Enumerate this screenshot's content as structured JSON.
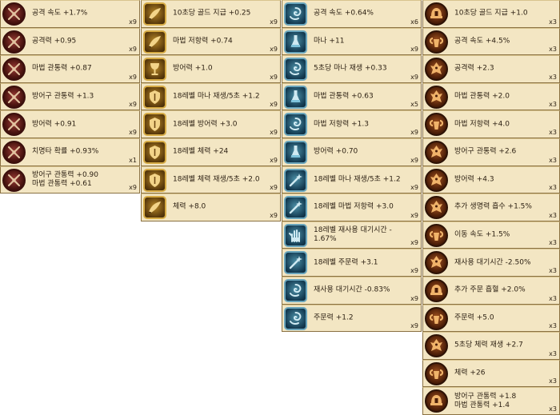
{
  "columns": [
    {
      "id": "col-1",
      "icon_style": "red",
      "items": [
        {
          "label": "공격 속도 +1.7%",
          "count": "x9",
          "icon": "swords-icon"
        },
        {
          "label": "공격력 +0.95",
          "count": "x9",
          "icon": "swords-icon"
        },
        {
          "label": "마법 관통력 +0.87",
          "count": "x9",
          "icon": "swords-icon"
        },
        {
          "label": "방어구 관통력 +1.3",
          "count": "x9",
          "icon": "swords-icon"
        },
        {
          "label": "방어력 +0.91",
          "count": "x9",
          "icon": "swords-icon"
        },
        {
          "label": "치명타 확률 +0.93%",
          "count": "x1",
          "icon": "swords-icon"
        },
        {
          "label": "방어구 관통력 +0.90\n마법 관통력 +0.61",
          "count": "x9",
          "icon": "swords-icon"
        }
      ]
    },
    {
      "id": "col-2",
      "icon_style": "gold",
      "items": [
        {
          "label": "10초당 골드 지급 +0.25",
          "count": "x9",
          "icon": "horn-icon"
        },
        {
          "label": "마법 저항력 +0.74",
          "count": "x9",
          "icon": "horn-icon"
        },
        {
          "label": "방어력 +1.0",
          "count": "x9",
          "icon": "chalice-icon"
        },
        {
          "label": "18레벨 마나 재생/5초 +1.2",
          "count": "x9",
          "icon": "shield-icon"
        },
        {
          "label": "18레벨 방어력 +3.0",
          "count": "x9",
          "icon": "shield-icon"
        },
        {
          "label": "18레벨 체력 +24",
          "count": "x9",
          "icon": "shield-icon"
        },
        {
          "label": "18레벨 체력 재생/5초 +2.0",
          "count": "x9",
          "icon": "shield-icon"
        },
        {
          "label": "체력 +8.0",
          "count": "x9",
          "icon": "horn-icon"
        }
      ]
    },
    {
      "id": "col-3",
      "icon_style": "blue",
      "items": [
        {
          "label": "공격 속도 +0.64%",
          "count": "x6",
          "icon": "swirl-icon"
        },
        {
          "label": "마나 +11",
          "count": "x9",
          "icon": "flask-icon"
        },
        {
          "label": "5초당 마나 재생 +0.33",
          "count": "x9",
          "icon": "swirl-icon"
        },
        {
          "label": "마법 관통력 +0.63",
          "count": "x5",
          "icon": "flask-icon"
        },
        {
          "label": "마법 저항력 +1.3",
          "count": "x9",
          "icon": "swirl-icon"
        },
        {
          "label": "방어력 +0.70",
          "count": "x9",
          "icon": "flask-icon"
        },
        {
          "label": "18레벨 마나 재생/5초 +1.2",
          "count": "x9",
          "icon": "wand-icon"
        },
        {
          "label": "18레벨 마법 저항력 +3.0",
          "count": "x9",
          "icon": "wand-icon"
        },
        {
          "label": "18레벨 재사용 대기시간 -\n1.67%",
          "count": "x9",
          "icon": "hand-icon"
        },
        {
          "label": "18레벨 주문력 +3.1",
          "count": "x9",
          "icon": "wand-icon"
        },
        {
          "label": "재사용 대기시간 -0.83%",
          "count": "x9",
          "icon": "swirl-icon"
        },
        {
          "label": "주문력 +1.2",
          "count": "x9",
          "icon": "swirl-icon"
        }
      ]
    },
    {
      "id": "col-4",
      "icon_style": "brown",
      "items": [
        {
          "label": "10초당 골드 지급 +1.0",
          "count": "x3",
          "icon": "helmet-icon"
        },
        {
          "label": "공격 속도 +4.5%",
          "count": "x3",
          "icon": "ram-icon"
        },
        {
          "label": "공격력 +2.3",
          "count": "x3",
          "icon": "dragon-icon"
        },
        {
          "label": "마법 관통력 +2.0",
          "count": "x3",
          "icon": "dragon-icon"
        },
        {
          "label": "마법 저항력 +4.0",
          "count": "x3",
          "icon": "ram-icon"
        },
        {
          "label": "방어구 관통력 +2.6",
          "count": "x3",
          "icon": "dragon-icon"
        },
        {
          "label": "방어력 +4.3",
          "count": "x3",
          "icon": "dragon-icon"
        },
        {
          "label": "추가 생명력 흡수 +1.5%",
          "count": "x3",
          "icon": "dragon-icon"
        },
        {
          "label": "이동 속도 +1.5%",
          "count": "x3",
          "icon": "ram-icon"
        },
        {
          "label": "재사용 대기시간 -2.50%",
          "count": "x3",
          "icon": "dragon-icon"
        },
        {
          "label": "추가 주문 흡혈 +2.0%",
          "count": "x3",
          "icon": "helmet-icon"
        },
        {
          "label": "주문력 +5.0",
          "count": "x3",
          "icon": "ram-icon"
        },
        {
          "label": "5초당 체력 재생 +2.7",
          "count": "x3",
          "icon": "dragon-icon"
        },
        {
          "label": "체력 +26",
          "count": "x3",
          "icon": "ram-icon"
        },
        {
          "label": "방어구 관통력 +1.8\n마법 관통력 +1.4",
          "count": "x3",
          "icon": "helmet-icon"
        }
      ]
    }
  ],
  "colors": {
    "cell_bg": "#f3e6c3",
    "text": "#2e2214",
    "column_bg": "#112a44",
    "red_icon": "#7a2420",
    "gold_icon": "#b8892a",
    "blue_icon": "#3f7f96",
    "brown_icon": "#8a4516"
  }
}
